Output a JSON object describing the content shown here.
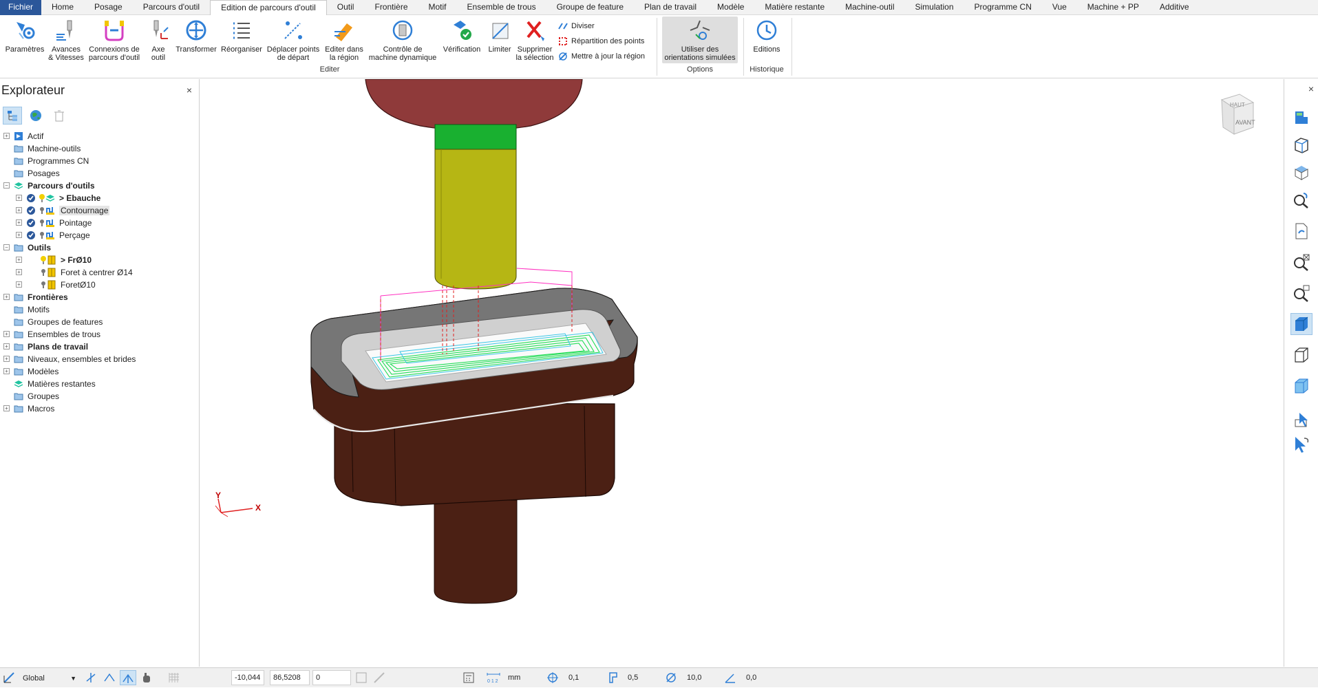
{
  "menu": {
    "tabs": [
      "Fichier",
      "Home",
      "Posage",
      "Parcours d'outil",
      "Edition de parcours d'outil",
      "Outil",
      "Frontière",
      "Motif",
      "Ensemble de trous",
      "Groupe de feature",
      "Plan de travail",
      "Modèle",
      "Matière restante",
      "Machine-outil",
      "Simulation",
      "Programme CN",
      "Vue",
      "Machine + PP",
      "Additive"
    ],
    "active": "Edition de parcours d'outil"
  },
  "ribbon": {
    "buttons": [
      {
        "l1": "Paramètres",
        "l2": ""
      },
      {
        "l1": "Avances",
        "l2": "& Vitesses"
      },
      {
        "l1": "Connexions de",
        "l2": "parcours d'outil"
      },
      {
        "l1": "Axe",
        "l2": "outil"
      },
      {
        "l1": "Transformer",
        "l2": ""
      },
      {
        "l1": "Réorganiser",
        "l2": ""
      },
      {
        "l1": "Déplacer points",
        "l2": "de départ"
      },
      {
        "l1": "Editer dans",
        "l2": "la région"
      },
      {
        "l1": "Contrôle de",
        "l2": "machine dynamique"
      },
      {
        "l1": "Vérification",
        "l2": ""
      },
      {
        "l1": "Limiter",
        "l2": ""
      },
      {
        "l1": "Supprimer",
        "l2": "la sélection"
      }
    ],
    "small": [
      "Diviser",
      "Répartition des points",
      "Mettre à jour la région"
    ],
    "options_btn": {
      "l1": "Utiliser des",
      "l2": "orientations simulées"
    },
    "history_btn": "Editions",
    "groups": {
      "edit": "Editer",
      "options": "Options",
      "history": "Historique"
    }
  },
  "explorer": {
    "title": "Explorateur",
    "close": "×",
    "tree": [
      {
        "label": "Actif",
        "bold": false,
        "level": 0,
        "expander": "+"
      },
      {
        "label": "Machine-outils",
        "bold": false,
        "level": 0,
        "expander": ""
      },
      {
        "label": "Programmes CN",
        "bold": false,
        "level": 0,
        "expander": ""
      },
      {
        "label": "Posages",
        "bold": false,
        "level": 0,
        "expander": ""
      },
      {
        "label": "Parcours d'outils",
        "bold": true,
        "level": 0,
        "expander": "−"
      },
      {
        "label": "> Ebauche",
        "bold": true,
        "level": 1,
        "expander": "+"
      },
      {
        "label": "Contournage",
        "bold": false,
        "level": 1,
        "expander": "+",
        "selected": true
      },
      {
        "label": "Pointage",
        "bold": false,
        "level": 1,
        "expander": "+"
      },
      {
        "label": "Perçage",
        "bold": false,
        "level": 1,
        "expander": "+"
      },
      {
        "label": "Outils",
        "bold": true,
        "level": 0,
        "expander": "−"
      },
      {
        "label": "> FrØ10",
        "bold": true,
        "level": 1,
        "expander": "+"
      },
      {
        "label": "Foret à centrer Ø14",
        "bold": false,
        "level": 1,
        "expander": "+"
      },
      {
        "label": "ForetØ10",
        "bold": false,
        "level": 1,
        "expander": "+"
      },
      {
        "label": "Frontières",
        "bold": true,
        "level": 0,
        "expander": "+"
      },
      {
        "label": "Motifs",
        "bold": false,
        "level": 0,
        "expander": ""
      },
      {
        "label": "Groupes de features",
        "bold": false,
        "level": 0,
        "expander": ""
      },
      {
        "label": "Ensembles de trous",
        "bold": false,
        "level": 0,
        "expander": "+"
      },
      {
        "label": "Plans de travail",
        "bold": true,
        "level": 0,
        "expander": "+"
      },
      {
        "label": "Niveaux, ensembles et brides",
        "bold": false,
        "level": 0,
        "expander": "+"
      },
      {
        "label": "Modèles",
        "bold": false,
        "level": 0,
        "expander": "+"
      },
      {
        "label": "Matières restantes",
        "bold": false,
        "level": 0,
        "expander": ""
      },
      {
        "label": "Groupes",
        "bold": false,
        "level": 0,
        "expander": ""
      },
      {
        "label": "Macros",
        "bold": false,
        "level": 0,
        "expander": "+"
      }
    ]
  },
  "viewcube": {
    "top": "HAUT",
    "front": "AVANT"
  },
  "axes": {
    "x": "X",
    "y": "Y"
  },
  "rightbar_close": "×",
  "status": {
    "workplane": "Global",
    "x": "-10,044",
    "y": "86,5208",
    "z": "0",
    "units": "mm",
    "tolerance": "0,1",
    "thickness": "0,5",
    "diameter": "10,0",
    "angle": "0,0"
  },
  "colors": {
    "accent": "#2b579a",
    "stock": "#4b2014",
    "spindle": "#8f3a3a",
    "collar": "#19b030",
    "tool": "#b6b614",
    "toolpath": "#22dd55"
  }
}
